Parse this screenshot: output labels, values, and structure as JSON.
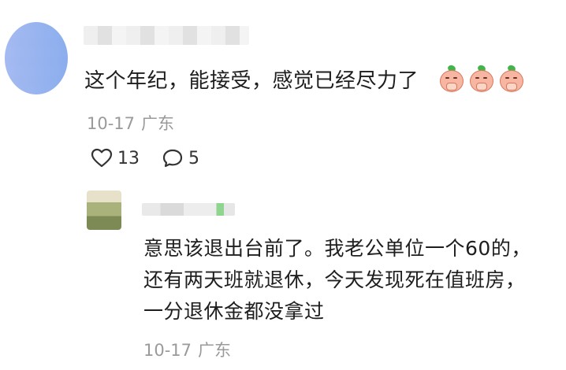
{
  "comment": {
    "text": "这个年纪，能接受，感觉已经尽力了",
    "emojis": [
      "pray-emoji",
      "pray-emoji",
      "pray-emoji"
    ],
    "date": "10-17",
    "location": "广东",
    "like_count": "13",
    "reply_count": "5"
  },
  "reply": {
    "lines": [
      "意思该退出台前了。我老公单位一个60的，",
      "还有两天班就退休，今天发现死在值班房，",
      "一分退休金都没拿过"
    ],
    "date": "10-17",
    "location": "广东"
  },
  "colors": {
    "text": "#1e1e1e",
    "meta": "#9a9a9a",
    "background": "#ffffff"
  }
}
